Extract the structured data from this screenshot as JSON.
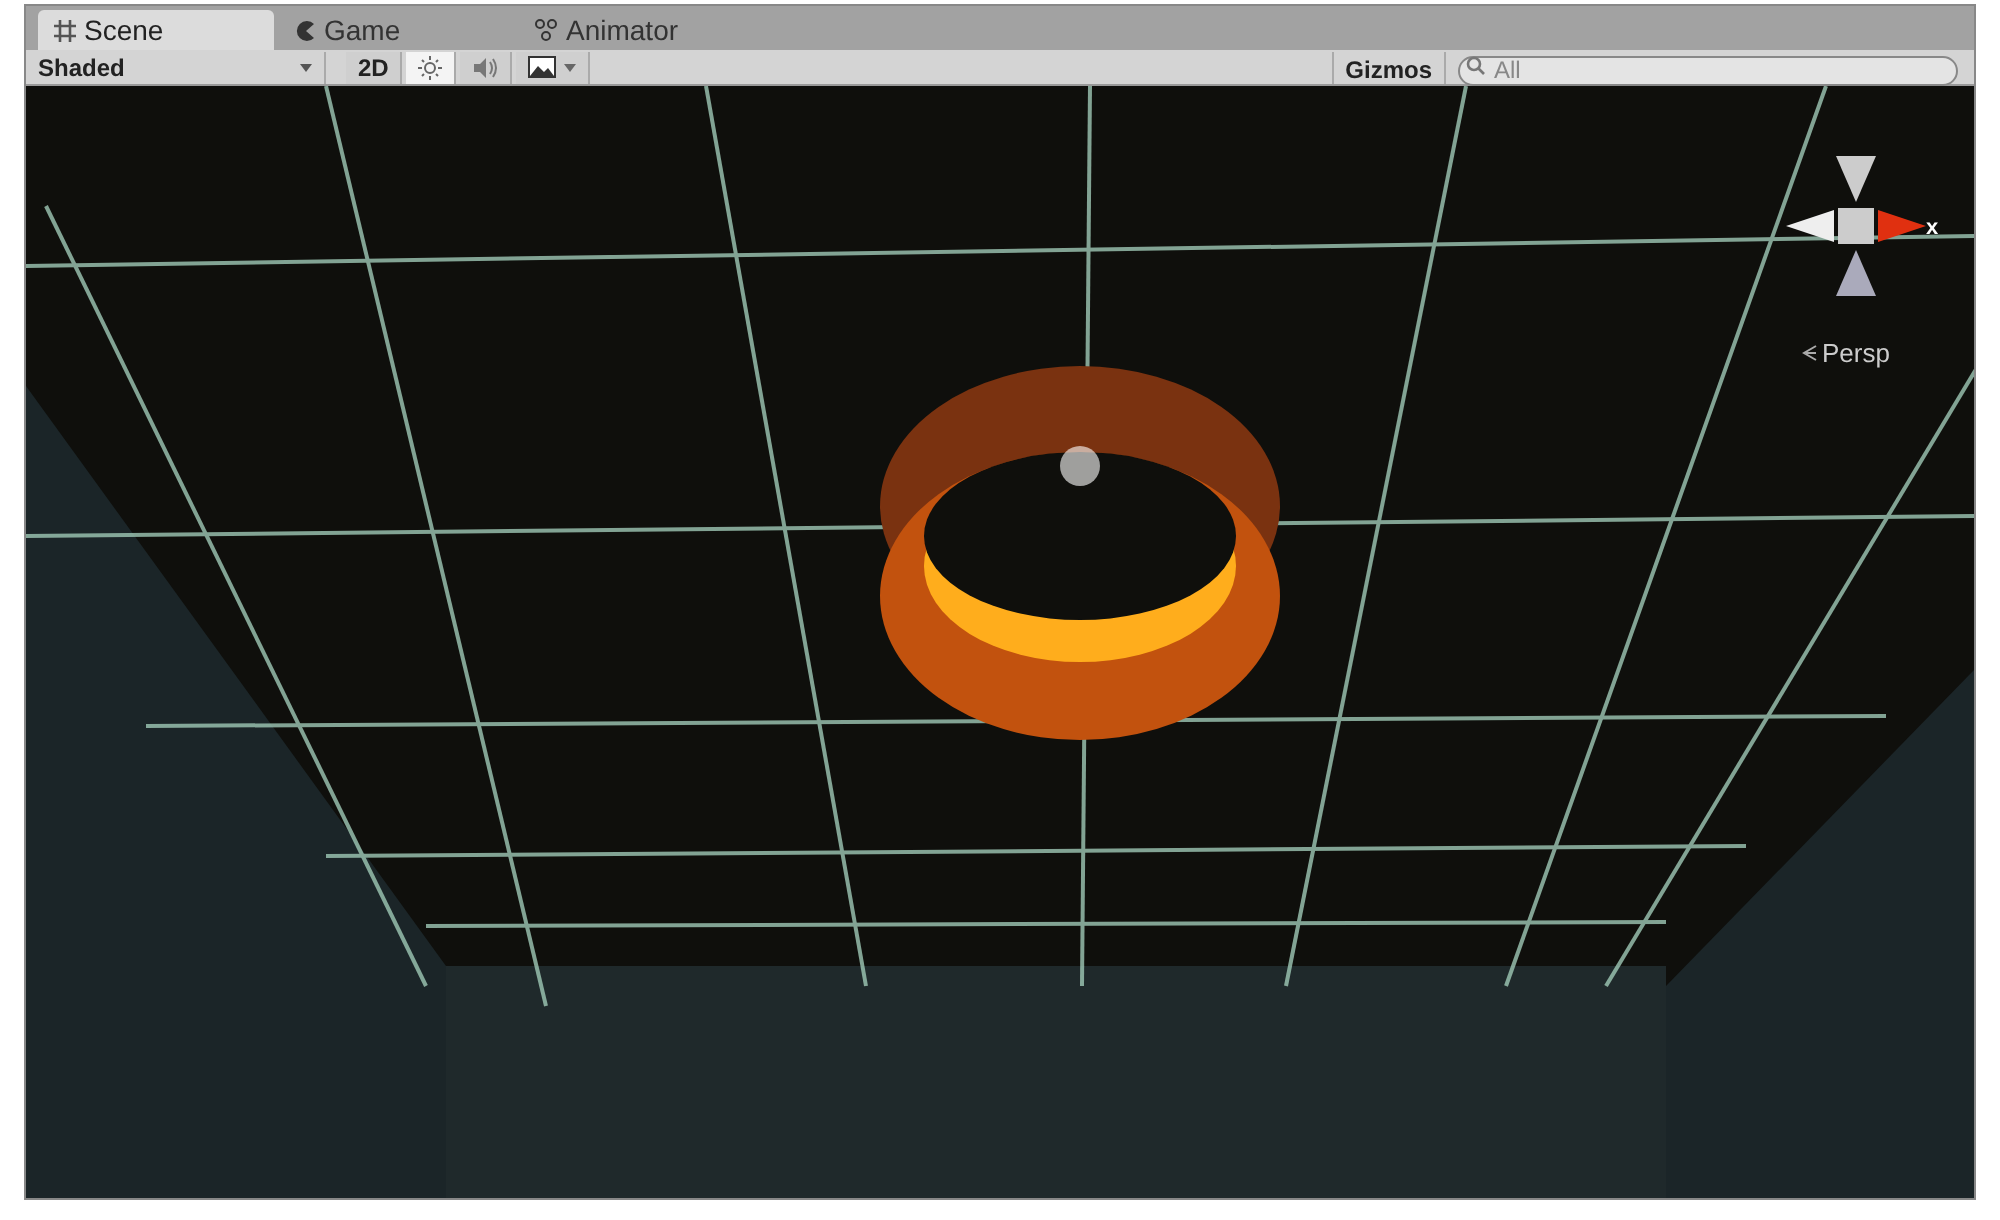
{
  "tabs": [
    {
      "label": "Scene",
      "kind": "scene",
      "selected": true
    },
    {
      "label": "Game",
      "kind": "game",
      "selected": false
    },
    {
      "label": "Animator",
      "kind": "animator",
      "selected": false
    }
  ],
  "toolbar": {
    "shading_mode": "Shaded",
    "toggles": [
      {
        "kind": "text",
        "label": "2D",
        "selected": false
      },
      {
        "kind": "lighting",
        "selected": true
      },
      {
        "kind": "audio",
        "selected": false
      },
      {
        "kind": "effects",
        "selected": false
      }
    ],
    "gizmos": "Gizmos",
    "search": {
      "placeholder": "All"
    }
  },
  "viewport": {
    "axis_label": "x",
    "projection": "Persp"
  }
}
